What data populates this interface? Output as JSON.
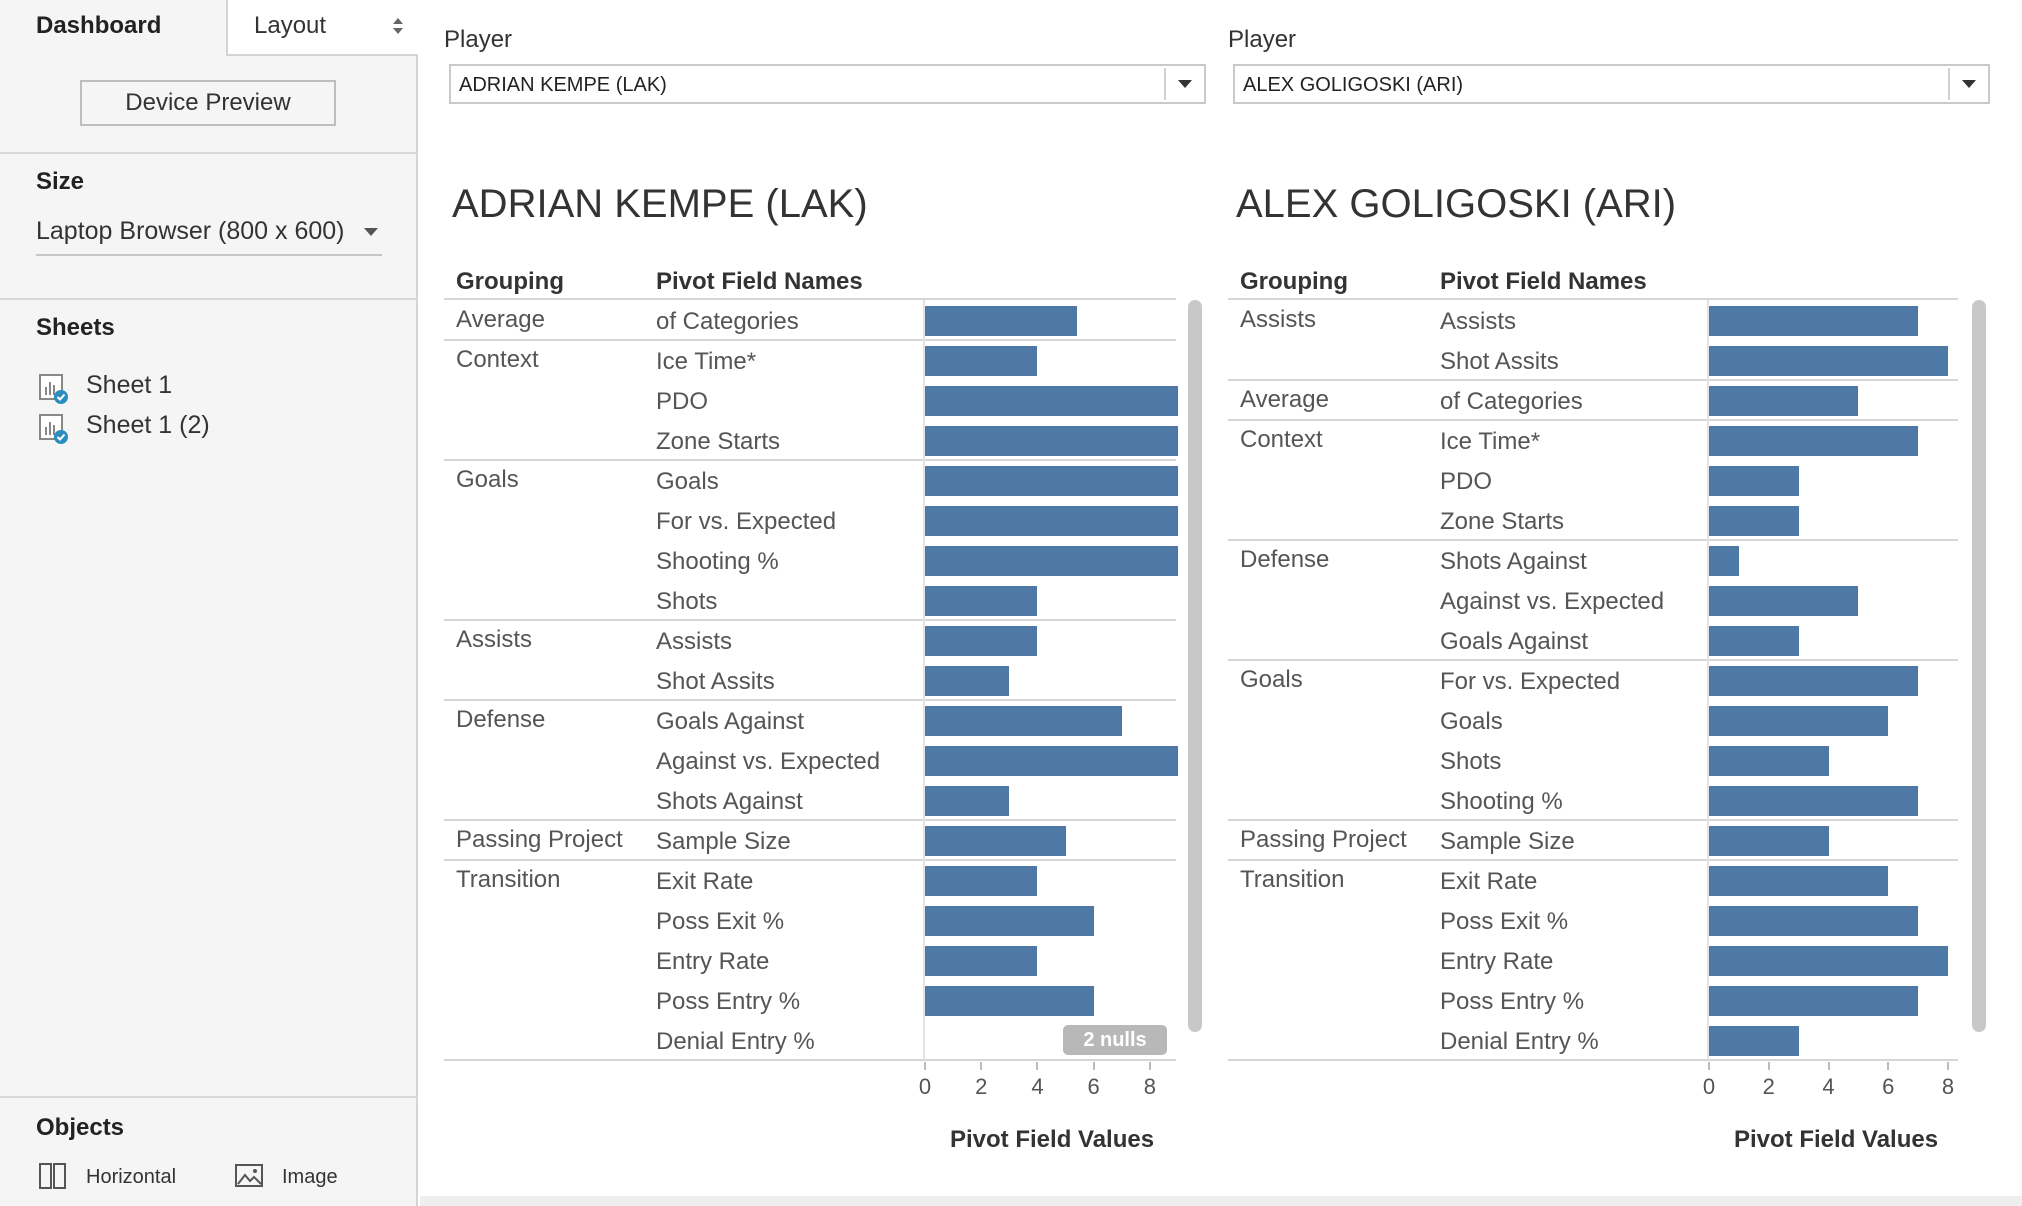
{
  "sidebar": {
    "tab_dashboard": "Dashboard",
    "tab_layout": "Layout",
    "device_preview": "Device Preview",
    "size_title": "Size",
    "size_value": "Laptop Browser (800 x 600)",
    "sheets_title": "Sheets",
    "sheets": [
      {
        "label": "Sheet 1"
      },
      {
        "label": "Sheet 1 (2)"
      }
    ],
    "objects_title": "Objects",
    "objects": [
      {
        "label": "Horizontal",
        "icon": "horizontal-container-icon"
      },
      {
        "label": "Image",
        "icon": "image-icon"
      }
    ]
  },
  "filters": [
    {
      "label": "Player",
      "value": "ADRIAN KEMPE (LAK)"
    },
    {
      "label": "Player",
      "value": "ALEX GOLIGOSKI (ARI)"
    }
  ],
  "colors": {
    "bar": "#4e79a7",
    "sidebar_bg": "#f5f5f5",
    "checkmark": "#2b8cbe"
  },
  "chart_data": [
    {
      "type": "bar",
      "title": "ADRIAN KEMPE (LAK)",
      "col_headers": [
        "Grouping",
        "Pivot Field Names"
      ],
      "xlabel": "Pivot Field Values",
      "xticks": [
        "0",
        "2",
        "4",
        "6",
        "8"
      ],
      "xlim": [
        0,
        9
      ],
      "groups": [
        {
          "name": "Average",
          "items": [
            {
              "name": "of Categories",
              "value": 5.4
            }
          ]
        },
        {
          "name": "Context",
          "items": [
            {
              "name": "Ice Time*",
              "value": 4
            },
            {
              "name": "PDO",
              "value": 9
            },
            {
              "name": "Zone Starts",
              "value": 9
            }
          ]
        },
        {
          "name": "Goals",
          "items": [
            {
              "name": "Goals",
              "value": 9
            },
            {
              "name": "For vs. Expected",
              "value": 9
            },
            {
              "name": "Shooting %",
              "value": 9
            },
            {
              "name": "Shots",
              "value": 4
            }
          ]
        },
        {
          "name": "Assists",
          "items": [
            {
              "name": "Assists",
              "value": 4
            },
            {
              "name": "Shot Assits",
              "value": 3
            }
          ]
        },
        {
          "name": "Defense",
          "items": [
            {
              "name": "Goals Against",
              "value": 7
            },
            {
              "name": "Against vs. Expected",
              "value": 9
            },
            {
              "name": "Shots Against",
              "value": 3
            }
          ]
        },
        {
          "name": "Passing Project",
          "items": [
            {
              "name": "Sample Size",
              "value": 5
            }
          ]
        },
        {
          "name": "Transition",
          "items": [
            {
              "name": "Exit Rate",
              "value": 4
            },
            {
              "name": "Poss Exit %",
              "value": 6
            },
            {
              "name": "Entry Rate",
              "value": 4
            },
            {
              "name": "Poss Entry %",
              "value": 6
            },
            {
              "name": "Denial Entry %",
              "value": null
            }
          ]
        }
      ],
      "nulls_label": "2 nulls"
    },
    {
      "type": "bar",
      "title": "ALEX GOLIGOSKI (ARI)",
      "col_headers": [
        "Grouping",
        "Pivot Field Names"
      ],
      "xlabel": "Pivot Field Values",
      "xticks": [
        "0",
        "2",
        "4",
        "6",
        "8"
      ],
      "xlim": [
        0,
        8.4
      ],
      "groups": [
        {
          "name": "Assists",
          "items": [
            {
              "name": "Assists",
              "value": 7
            },
            {
              "name": "Shot Assits",
              "value": 8
            }
          ]
        },
        {
          "name": "Average",
          "items": [
            {
              "name": "of Categories",
              "value": 5
            }
          ]
        },
        {
          "name": "Context",
          "items": [
            {
              "name": "Ice Time*",
              "value": 7
            },
            {
              "name": "PDO",
              "value": 3
            },
            {
              "name": "Zone Starts",
              "value": 3
            }
          ]
        },
        {
          "name": "Defense",
          "items": [
            {
              "name": "Shots Against",
              "value": 1
            },
            {
              "name": "Against vs. Expected",
              "value": 5
            },
            {
              "name": "Goals Against",
              "value": 3
            }
          ]
        },
        {
          "name": "Goals",
          "items": [
            {
              "name": "For vs. Expected",
              "value": 7
            },
            {
              "name": "Goals",
              "value": 6
            },
            {
              "name": "Shots",
              "value": 4
            },
            {
              "name": "Shooting %",
              "value": 7
            }
          ]
        },
        {
          "name": "Passing Project",
          "items": [
            {
              "name": "Sample Size",
              "value": 4
            }
          ]
        },
        {
          "name": "Transition",
          "items": [
            {
              "name": "Exit Rate",
              "value": 6
            },
            {
              "name": "Poss Exit %",
              "value": 7
            },
            {
              "name": "Entry Rate",
              "value": 8
            },
            {
              "name": "Poss Entry %",
              "value": 7
            },
            {
              "name": "Denial Entry %",
              "value": 3
            }
          ]
        }
      ]
    }
  ]
}
